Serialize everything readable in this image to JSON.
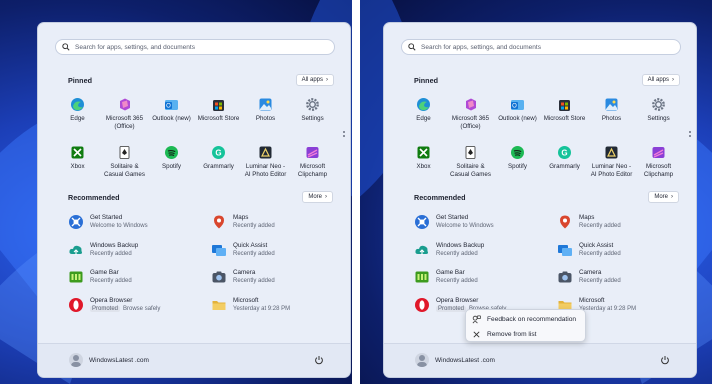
{
  "search": {
    "placeholder": "Search for apps, settings, and documents"
  },
  "pinned": {
    "title": "Pinned",
    "all_apps": "All apps",
    "apps": [
      {
        "label": "Edge",
        "icon": "edge-icon",
        "color": "#1f8fd6"
      },
      {
        "label": "Microsoft 365\n(Office)",
        "icon": "office-icon",
        "color": "#b04ad6"
      },
      {
        "label": "Outlook (new)",
        "icon": "outlook-icon",
        "color": "#1173d4"
      },
      {
        "label": "Microsoft Store",
        "icon": "store-icon",
        "color": "#2d6fdc"
      },
      {
        "label": "Photos",
        "icon": "photos-icon",
        "color": "#2a8ae0"
      },
      {
        "label": "Settings",
        "icon": "gear-icon",
        "color": "#6c7585"
      },
      {
        "label": "Xbox",
        "icon": "xbox-icon",
        "color": "#107c10"
      },
      {
        "label": "Solitaire &\nCasual Games",
        "icon": "solitaire-icon",
        "color": "#2d3a4a"
      },
      {
        "label": "Spotify",
        "icon": "spotify-icon",
        "color": "#1db954"
      },
      {
        "label": "Grammarly",
        "icon": "grammarly-icon",
        "color": "#15c39a"
      },
      {
        "label": "Luminar Neo -\nAI Photo Editor",
        "icon": "luminar-icon",
        "color": "#222a35"
      },
      {
        "label": "Microsoft\nClipchamp",
        "icon": "clipchamp-icon",
        "color": "#8a3fd6"
      }
    ]
  },
  "recommended": {
    "title": "Recommended",
    "more": "More",
    "items": [
      {
        "title": "Get Started",
        "sub": "Welcome to Windows",
        "icon": "get-started-icon",
        "color": "#2a6fd6"
      },
      {
        "title": "Maps",
        "sub": "Recently added",
        "icon": "maps-icon",
        "color": "#d9462e"
      },
      {
        "title": "Windows Backup",
        "sub": "Recently added",
        "icon": "backup-icon",
        "color": "#1a9d8f"
      },
      {
        "title": "Quick Assist",
        "sub": "Recently added",
        "icon": "quick-assist-icon",
        "color": "#1f78d8"
      },
      {
        "title": "Game Bar",
        "sub": "Recently added",
        "icon": "gamebar-icon",
        "color": "#3d9b1e"
      },
      {
        "title": "Camera",
        "sub": "Recently added",
        "icon": "camera-icon",
        "color": "#4b5566"
      },
      {
        "title": "Opera Browser",
        "tag": "Promoted",
        "sub": "Browse safely",
        "icon": "opera-icon",
        "color": "#e0182a"
      },
      {
        "title": "Microsoft",
        "sub": "Yesterday at 9:28 PM",
        "icon": "folder-icon",
        "color": "#e3b23c"
      }
    ]
  },
  "footer": {
    "user": "WindowsLatest .com"
  },
  "context_menu": {
    "items": [
      {
        "label": "Feedback on recommendation",
        "icon": "feedback-icon"
      },
      {
        "label": "Remove from list",
        "icon": "close-icon"
      }
    ]
  }
}
